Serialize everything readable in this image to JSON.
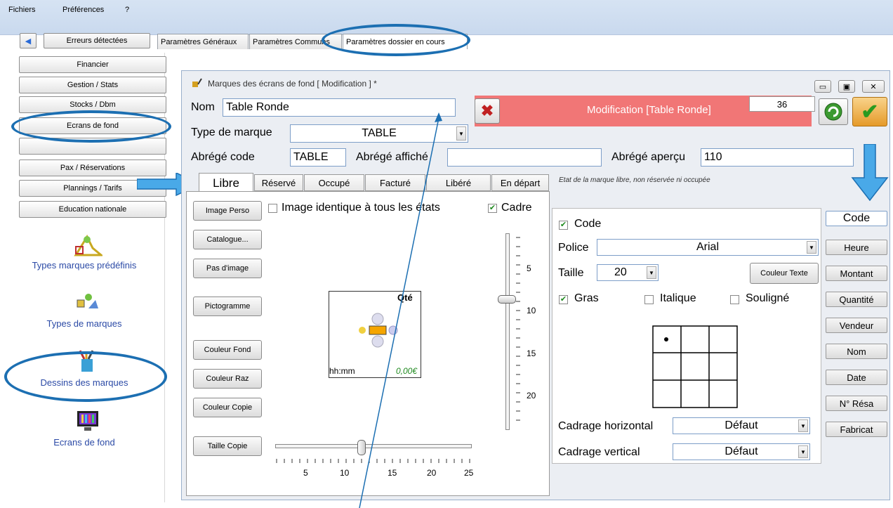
{
  "menu": {
    "file": "Fichiers",
    "prefs": "Préférences",
    "help": "?"
  },
  "toolbar": {
    "errors": "Erreurs détectées"
  },
  "top_tabs": [
    "Paramètres Généraux",
    "Paramètres Communs",
    "Paramètres dossier en cours"
  ],
  "nav": [
    "Financier",
    "Gestion / Stats",
    "Stocks / Dbm",
    "Ecrans de fond",
    "",
    "Pax / Réservations",
    "Plannings / Tarifs",
    "Education nationale"
  ],
  "side_links": [
    "Types marques prédéfinis",
    "Types de marques",
    "Dessins des marques",
    "Ecrans de fond"
  ],
  "window": {
    "title": "Marques des écrans de fond [ Modification ] *"
  },
  "form": {
    "nom_label": "Nom",
    "nom_value": "Table Ronde",
    "type_label": "Type de marque",
    "type_value": "TABLE",
    "abrege_code_label": "Abrégé code",
    "abrege_code_value": "TABLE",
    "abrege_affiche_label": "Abrégé affiché",
    "abrege_affiche_value": "",
    "abrege_apercu_label": "Abrégé aperçu",
    "abrege_apercu_value": "110",
    "status": "Modification [Table Ronde]",
    "number": "36"
  },
  "state_tabs": [
    "Libre",
    "Réservé",
    "Occupé",
    "Facturé",
    "Libéré",
    "En départ"
  ],
  "state_hint": "Etat de la marque libre, non réservée ni occupée",
  "left_buttons": [
    "Image Perso",
    "Catalogue...",
    "Pas d'image",
    "Pictogramme",
    "Couleur Fond",
    "Couleur Raz",
    "Couleur Copie",
    "Taille Copie"
  ],
  "image_identique": "Image identique à tous les états",
  "cadre": "Cadre",
  "preview": {
    "qte": "Qté",
    "time": "hh:mm",
    "price": "0,00€"
  },
  "vslider_labels": [
    "5",
    "10",
    "15",
    "20"
  ],
  "hslider_labels": [
    "5",
    "10",
    "15",
    "20",
    "25"
  ],
  "props": {
    "code_chk": "Code",
    "police_label": "Police",
    "police_value": "Arial",
    "taille_label": "Taille",
    "taille_value": "20",
    "couleur_texte": "Couleur Texte",
    "gras": "Gras",
    "italique": "Italique",
    "souligne": "Souligné",
    "cadrage_h_label": "Cadrage horizontal",
    "cadrage_h_value": "Défaut",
    "cadrage_v_label": "Cadrage vertical",
    "cadrage_v_value": "Défaut"
  },
  "right_buttons": [
    "Code",
    "Heure",
    "Montant",
    "Quantité",
    "Vendeur",
    "Nom",
    "Date",
    "N° Résa",
    "Fabricat"
  ]
}
